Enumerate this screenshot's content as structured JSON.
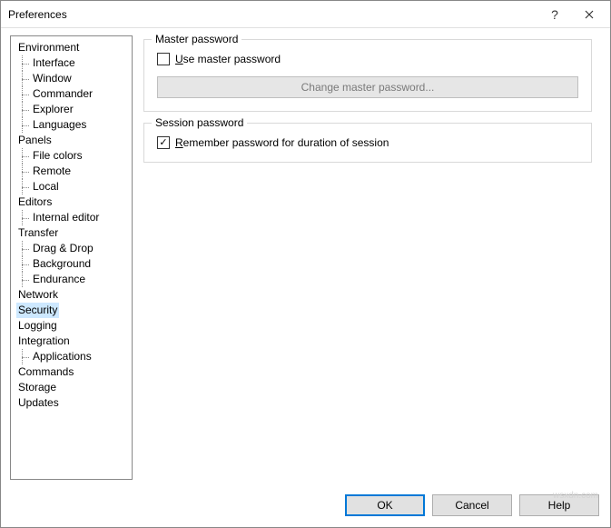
{
  "window": {
    "title": "Preferences"
  },
  "tree": {
    "environment": "Environment",
    "interface": "Interface",
    "window": "Window",
    "commander": "Commander",
    "explorer": "Explorer",
    "languages": "Languages",
    "panels": "Panels",
    "file_colors": "File colors",
    "remote": "Remote",
    "local": "Local",
    "editors": "Editors",
    "internal_editor": "Internal editor",
    "transfer": "Transfer",
    "drag_drop": "Drag & Drop",
    "background": "Background",
    "endurance": "Endurance",
    "network": "Network",
    "security": "Security",
    "logging": "Logging",
    "integration": "Integration",
    "applications": "Applications",
    "commands": "Commands",
    "storage": "Storage",
    "updates": "Updates"
  },
  "master_password": {
    "group_title": "Master password",
    "use_label_pre": "U",
    "use_label_rest": "se master password",
    "use_checked": false,
    "change_btn": "Change master password..."
  },
  "session_password": {
    "group_title": "Session password",
    "remember_label_pre": "R",
    "remember_label_rest": "emember password for duration of session",
    "remember_checked": true
  },
  "buttons": {
    "ok": "OK",
    "cancel": "Cancel",
    "help": "Help"
  },
  "watermark": "wsxdn.com"
}
